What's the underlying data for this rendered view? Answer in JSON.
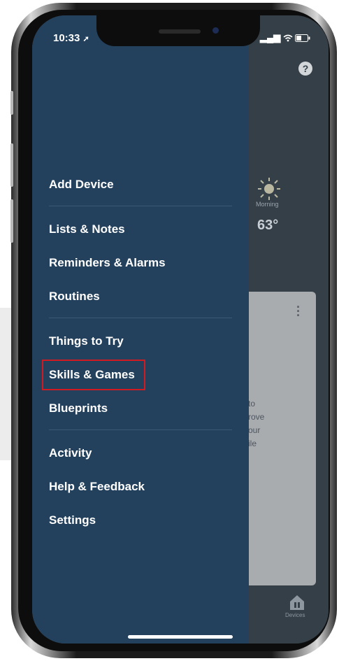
{
  "status_bar": {
    "time": "10:33",
    "signal_icon": "signal-bars-icon",
    "wifi_icon": "wifi-icon",
    "battery_icon": "battery-icon"
  },
  "background_app": {
    "weather": {
      "label": "Morning",
      "temperature": "63°",
      "icon": "sun-icon"
    },
    "card_text": [
      "to",
      "rove",
      "our",
      "ile"
    ],
    "help_icon": "?",
    "devices_label": "Devices"
  },
  "drawer": {
    "groups": [
      {
        "items": [
          "Add Device"
        ]
      },
      {
        "items": [
          "Lists & Notes",
          "Reminders & Alarms",
          "Routines"
        ]
      },
      {
        "items": [
          "Things to Try",
          "Skills & Games",
          "Blueprints"
        ]
      },
      {
        "items": [
          "Activity",
          "Help & Feedback",
          "Settings"
        ]
      }
    ],
    "highlighted_item": "Skills & Games",
    "highlight_color": "#d01b22",
    "drawer_color": "#23415d"
  }
}
